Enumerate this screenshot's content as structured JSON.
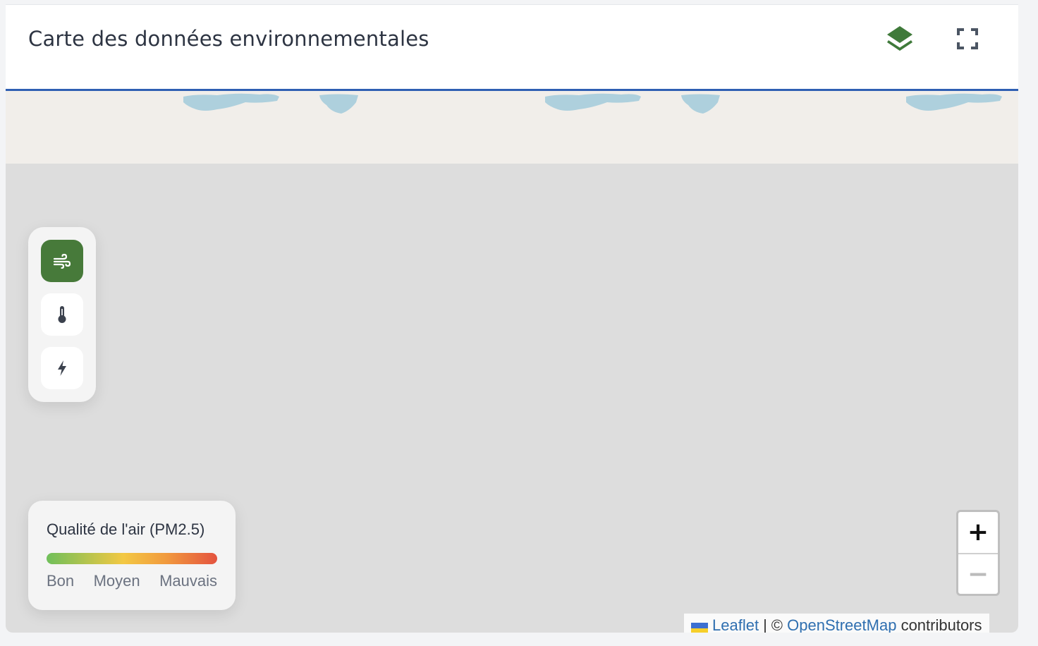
{
  "header": {
    "title": "Carte des données environnementales",
    "layers_icon": "layers-icon",
    "fullscreen_icon": "fullscreen-icon"
  },
  "map_controls": {
    "items": [
      {
        "icon": "wind-icon",
        "active": true
      },
      {
        "icon": "thermometer-icon",
        "active": false
      },
      {
        "icon": "lightning-icon",
        "active": false
      }
    ]
  },
  "legend": {
    "title": "Qualité de l'air (PM2.5)",
    "labels": [
      "Bon",
      "Moyen",
      "Mauvais"
    ],
    "gradient": [
      "#6fbf5a",
      "#f3c843",
      "#f19a3e",
      "#e4533f"
    ]
  },
  "zoom": {
    "in_label": "+",
    "out_label": "−"
  },
  "attribution": {
    "leaflet": "Leaflet",
    "separator": "|",
    "copyright": "©",
    "osm": "OpenStreetMap",
    "suffix": "contributors"
  },
  "colors": {
    "accent": "#2f5fb3",
    "active_green": "#477a3a",
    "water": "#aad3df",
    "land": "#f1eeea",
    "map_background": "#dddddd"
  }
}
